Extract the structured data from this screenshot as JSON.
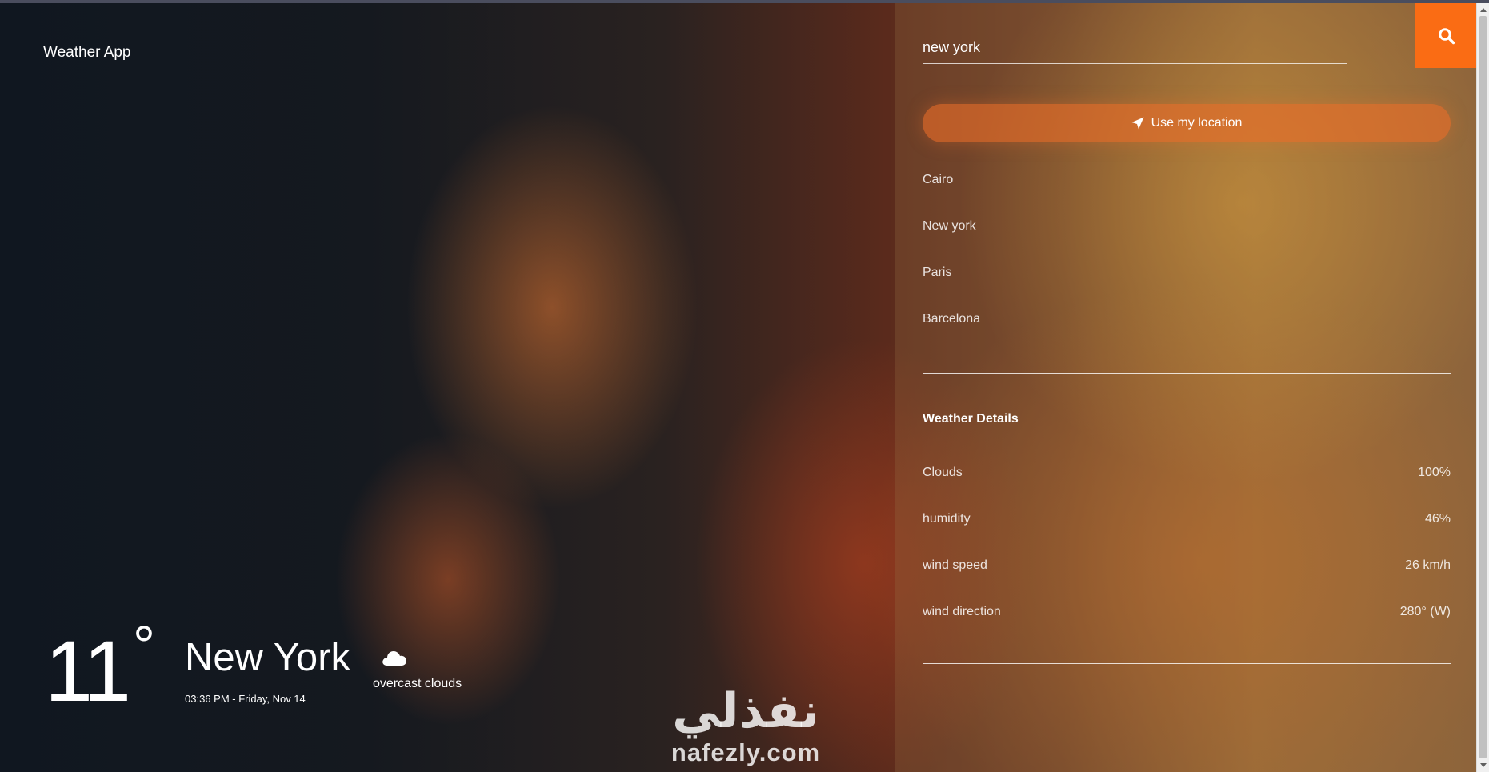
{
  "app": {
    "brand": "Weather App"
  },
  "current": {
    "temperature": "11",
    "degree_symbol": "°",
    "city": "New York",
    "datetime": "03:36 PM - Friday, Nov 14",
    "condition": "overcast clouds",
    "condition_icon": "cloud-icon"
  },
  "watermark": {
    "arabic": "نفذلي",
    "latin": "nafezly.com"
  },
  "search": {
    "value": "new york",
    "button_icon": "search-icon"
  },
  "location_button": {
    "label": "Use my location",
    "icon": "location-arrow-icon"
  },
  "cities": [
    {
      "label": "Cairo"
    },
    {
      "label": "New york"
    },
    {
      "label": "Paris"
    },
    {
      "label": "Barcelona"
    }
  ],
  "details": {
    "title": "Weather Details",
    "rows": [
      {
        "label": "Clouds",
        "value": "100%"
      },
      {
        "label": "humidity",
        "value": "46%"
      },
      {
        "label": "wind speed",
        "value": "26 km/h"
      },
      {
        "label": "wind direction",
        "value": "280° (W)"
      }
    ]
  },
  "colors": {
    "accent": "#fa6c14",
    "text": "#ffffff"
  }
}
